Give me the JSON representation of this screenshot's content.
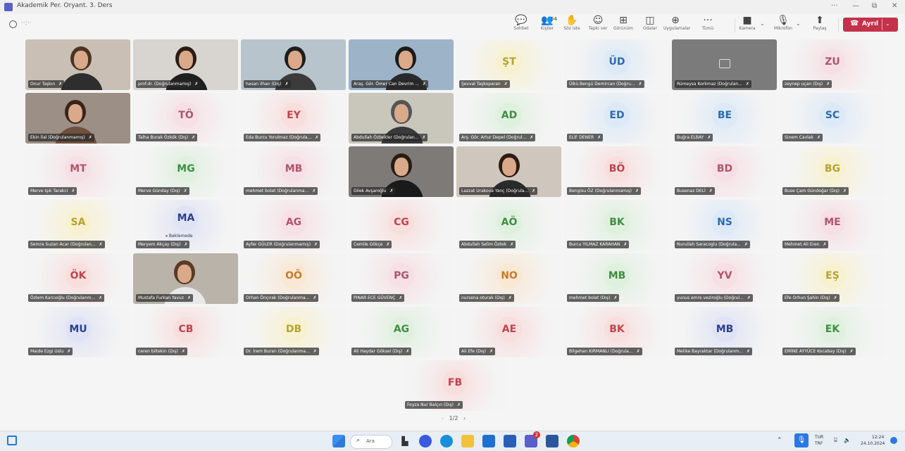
{
  "window": {
    "title": "Akademik Per. Oryant. 3. Ders",
    "controls": [
      "···",
      "—",
      "⧉",
      "✕"
    ]
  },
  "toolbar": {
    "timer": "··:··",
    "items": [
      {
        "id": "chat",
        "label": "Sohbet",
        "glyph": "💬",
        "icon": "chat-icon"
      },
      {
        "id": "people",
        "label": "Kişiler",
        "glyph": "👥",
        "icon": "people-icon",
        "count": "54"
      },
      {
        "id": "raise",
        "label": "Söz iste",
        "glyph": "✋",
        "icon": "raise-hand-icon"
      },
      {
        "id": "react",
        "label": "Tepki ver",
        "glyph": "☺",
        "icon": "react-icon"
      },
      {
        "id": "view",
        "label": "Görünüm",
        "glyph": "⊞",
        "icon": "view-icon"
      },
      {
        "id": "rooms",
        "label": "Odalar",
        "glyph": "◫",
        "icon": "rooms-icon"
      },
      {
        "id": "apps",
        "label": "Uygulamalar",
        "glyph": "⊕",
        "icon": "apps-icon"
      },
      {
        "id": "more",
        "label": "Tümü",
        "glyph": "···",
        "icon": "more-icon"
      },
      {
        "id": "camera",
        "label": "Kamera",
        "glyph": "■",
        "icon": "camera-icon"
      },
      {
        "id": "mic",
        "label": "Mikrofon",
        "glyph": "🎙",
        "icon": "mic-icon"
      },
      {
        "id": "share",
        "label": "Paylaş",
        "glyph": "⬆",
        "icon": "share-icon"
      }
    ],
    "leave_label": "Ayrıl"
  },
  "participants": [
    {
      "name": "Onur Taşkın",
      "video": true
    },
    {
      "name": "prof.dr. (Doğrulanmamış)",
      "video": true
    },
    {
      "name": "hasan ilhan (Dış)",
      "video": true
    },
    {
      "name": "Araş. Gör. Ömer Can Devrim ...",
      "video": true
    },
    {
      "name": "Şevval Taşkoparan",
      "initials": "ŞT",
      "color": "#b3a331"
    },
    {
      "name": "Ülkü Bengü Demircan (Doğru...",
      "initials": "ÜD",
      "color": "#2b6cb0"
    },
    {
      "name": "Rümeysa Korkmaz (Doğrulan...",
      "avatar": "grey"
    },
    {
      "name": "zeynep uçan (Dış)",
      "initials": "ZU",
      "color": "#b0556b"
    },
    {
      "name": "Ekin İlal (Doğrulanmamış)",
      "video": true
    },
    {
      "name": "Talha Burak Özkök (Dış)",
      "initials": "TÖ",
      "color": "#b0556b"
    },
    {
      "name": "Eda Burcu Yorulmaz (Doğrula...",
      "initials": "EY",
      "color": "#c0424e"
    },
    {
      "name": "Abdullah Özbekler (Doğrulan...",
      "video": true
    },
    {
      "name": "Arş. Gör. Artur Depel (Doğrul...",
      "initials": "AD",
      "color": "#3e8e41"
    },
    {
      "name": "ELİF DENER",
      "initials": "ED",
      "color": "#2b6cb0"
    },
    {
      "name": "Buğra ELBAY",
      "initials": "BE",
      "color": "#2b6cb0"
    },
    {
      "name": "Sinem Cavlak",
      "initials": "SC",
      "color": "#2b6cb0"
    },
    {
      "name": "Merve Işık Tarakci",
      "initials": "MT",
      "color": "#b0556b"
    },
    {
      "name": "Merve Günday (Dış)",
      "initials": "MG",
      "color": "#3e8e41"
    },
    {
      "name": "mehmet bolat (Doğrulanma...",
      "initials": "MB",
      "color": "#b0556b"
    },
    {
      "name": "Dilek Avşaroğlu",
      "video": true
    },
    {
      "name": "Lazzat Urakova Yanç (Doğrula...",
      "video": true
    },
    {
      "name": "Bengisu ÖZ (Doğrulanmamış)",
      "initials": "BÖ",
      "color": "#c0424e"
    },
    {
      "name": "Busenaz DELİ",
      "initials": "BD",
      "color": "#b0556b"
    },
    {
      "name": "Buse Çam Gündoğar (Dış)",
      "initials": "BG",
      "color": "#b3a331"
    },
    {
      "name": "Semra Suzan Acar (Doğrulan...",
      "initials": "SA",
      "color": "#b3a331"
    },
    {
      "name": "Meryem Akçay (Dış)",
      "initials": "MA",
      "color": "#2b3f8e",
      "waiting": "⏸ Beklemede"
    },
    {
      "name": "Ayfer GÜLER (Doğrulanmamış)",
      "initials": "AG",
      "color": "#b0556b"
    },
    {
      "name": "Cemile Gökçe",
      "initials": "CG",
      "color": "#c0424e"
    },
    {
      "name": "Abdullah Selim Öztek",
      "initials": "AÖ",
      "color": "#3e8e41"
    },
    {
      "name": "Burcu YILMAZ KARAHAN",
      "initials": "BK",
      "color": "#3e8e41"
    },
    {
      "name": "Nurullah Saracoglu (Doğrula...",
      "initials": "NS",
      "color": "#2b6cb0"
    },
    {
      "name": "Mehmet Ali Eren",
      "initials": "ME",
      "color": "#b0556b"
    },
    {
      "name": "Özlem Karcıoğlu (Doğrulanm...",
      "initials": "ÖK",
      "color": "#c0424e"
    },
    {
      "name": "Mustafa Furkan Yavuz",
      "video": true
    },
    {
      "name": "Orhan Önçırak (Doğrulanma...",
      "initials": "OÖ",
      "color": "#c87a2b"
    },
    {
      "name": "PINAR ECE GÜVENÇ",
      "initials": "PG",
      "color": "#b0556b"
    },
    {
      "name": "nursena oturak (Dış)",
      "initials": "NO",
      "color": "#c87a2b"
    },
    {
      "name": "mehmet bolat (Dış)",
      "initials": "MB",
      "color": "#3e8e41"
    },
    {
      "name": "yunus emre veziroğlu (Doğrul...",
      "initials": "YV",
      "color": "#b0556b"
    },
    {
      "name": "Efe Orhun Şahin (Dış)",
      "initials": "EŞ",
      "color": "#b3a331"
    },
    {
      "name": "Maide Ezgi Uslu",
      "initials": "MU",
      "color": "#2b3f8e"
    },
    {
      "name": "ceren biltekin (Dış)",
      "initials": "CB",
      "color": "#c0424e"
    },
    {
      "name": "Dr. İrem Buran (Doğrulanma...",
      "initials": "DB",
      "color": "#b3a331"
    },
    {
      "name": "Ali Haydar Göksel (Dış)",
      "initials": "AG",
      "color": "#3e8e41"
    },
    {
      "name": "Ali Efe (Dış)",
      "initials": "AE",
      "color": "#c0424e"
    },
    {
      "name": "Bilgehan KIRMANLI (Doğrula...",
      "initials": "BK",
      "color": "#c0424e"
    },
    {
      "name": "Melike Bayraktar (Doğrulanm...",
      "initials": "MB",
      "color": "#2b3f8e"
    },
    {
      "name": "EMİNE AYYÜCE Kocabay (Dış)",
      "initials": "EK",
      "color": "#3e8e41"
    },
    {
      "name": "Feyza Nur Balçın (Dış)",
      "initials": "FB",
      "color": "#c0424e"
    }
  ],
  "pager": {
    "label": "1/2",
    "prev": "‹",
    "next": "›"
  },
  "taskbar": {
    "search_label": "Ara",
    "language": "TUR",
    "layout": "TRF",
    "time": "12:24",
    "date": "24.10.2024",
    "teams_badge": "2"
  }
}
